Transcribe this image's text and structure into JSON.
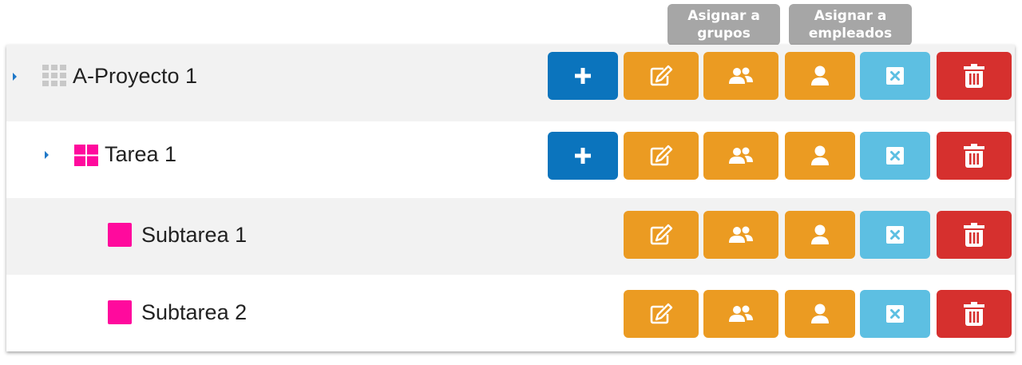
{
  "tooltips": {
    "groups": [
      "Asignar a",
      "grupos"
    ],
    "employees": [
      "Asignar a",
      "empleados"
    ]
  },
  "colors": {
    "add": "#0b74bd",
    "orange": "#eb9b22",
    "clear": "#5dbfe2",
    "delete": "#d6302e",
    "subtask": "#ff0a9d",
    "project_icon": "#c8c8c8"
  },
  "rows": [
    {
      "label": "A-Proyecto 1",
      "icon": "grid-icon"
    },
    {
      "label": "Tarea 1",
      "icon": "tiles-icon"
    },
    {
      "label": "Subtarea 1",
      "icon": "square-icon"
    },
    {
      "label": "Subtarea 2",
      "icon": "square-icon"
    }
  ]
}
